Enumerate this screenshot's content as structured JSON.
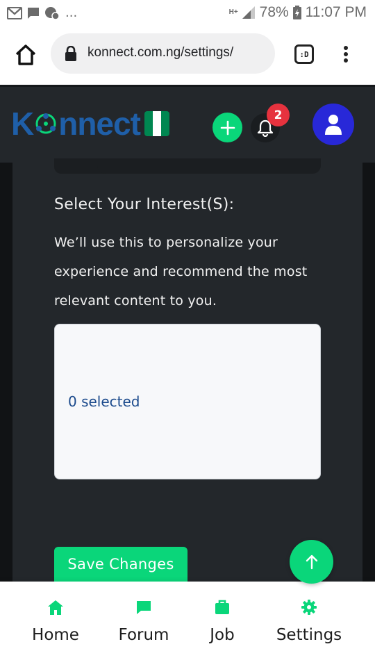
{
  "statusbar": {
    "ellipsis": "...",
    "network": "H+",
    "battery": "78%",
    "time": "11:07 PM"
  },
  "browser": {
    "url": "konnect.com.ng/settings/",
    "tab_label": ":D"
  },
  "header": {
    "logo_prefix": "K",
    "logo_suffix": "nnect",
    "notification_count": "2",
    "flag_colors": [
      "#008751",
      "#ffffff",
      "#008751"
    ]
  },
  "interests": {
    "title": "Select Your Interest(S):",
    "description": "We’ll use this to personalize your experience and recommend the most relevant content to you.",
    "selected_text": "0 selected"
  },
  "actions": {
    "save_label": "Save Changes"
  },
  "bottom_nav": {
    "items": [
      {
        "label": "Home",
        "icon": "home-icon"
      },
      {
        "label": "Forum",
        "icon": "chat-icon"
      },
      {
        "label": "Job",
        "icon": "briefcase-icon"
      },
      {
        "label": "Settings",
        "icon": "gear-icon"
      }
    ]
  },
  "colors": {
    "accent": "#0ad67a",
    "header_bg": "#23272b",
    "avatar_bg": "#2828d8",
    "badge": "#e6323e",
    "logo_blue": "#1f5fa8"
  }
}
